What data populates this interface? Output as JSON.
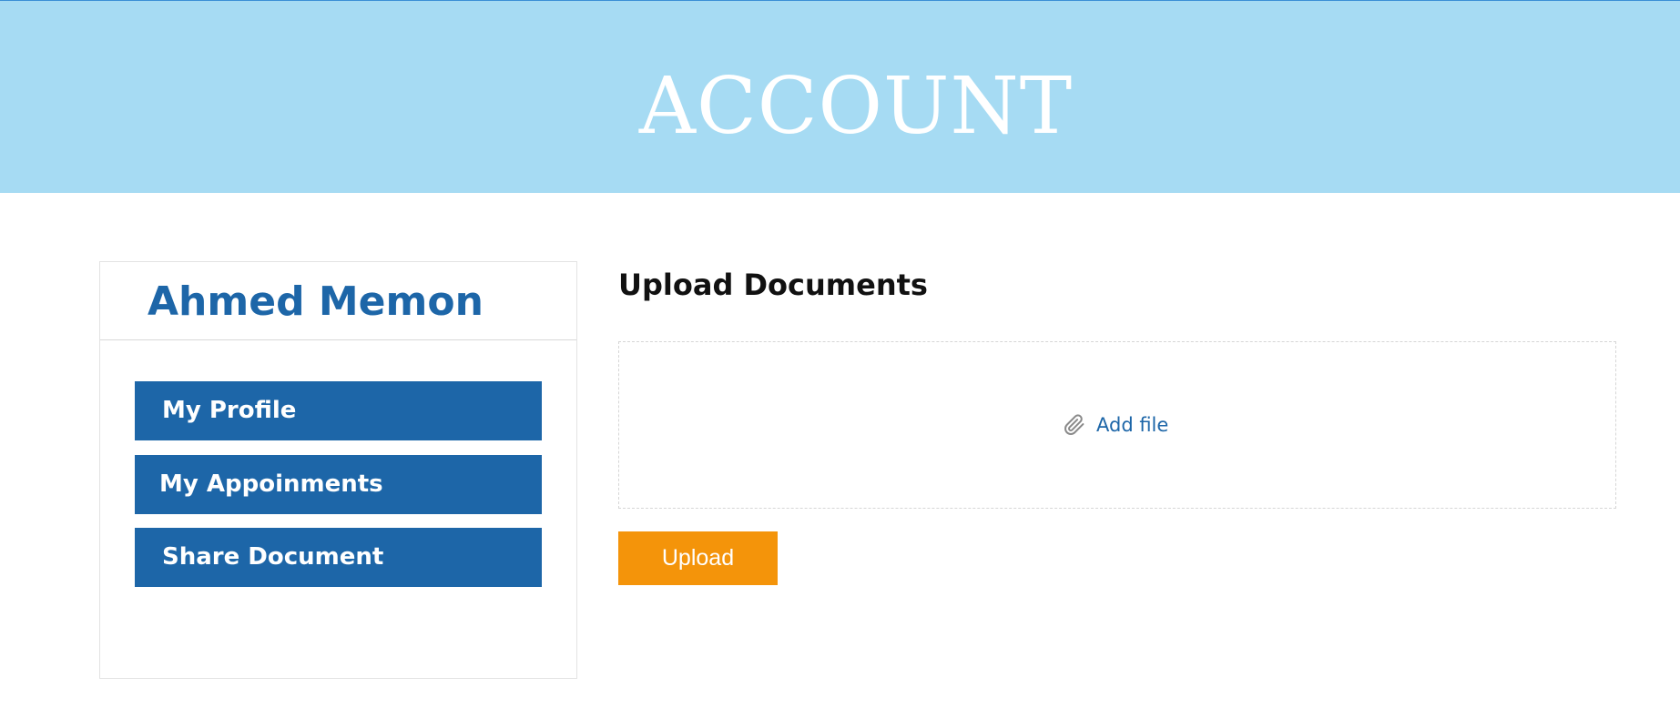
{
  "banner": {
    "title": "ACCOUNT"
  },
  "sidebar": {
    "user_name": "Ahmed Memon",
    "items": [
      {
        "label": "My Profile"
      },
      {
        "label": "My Appoinments"
      },
      {
        "label": "Share Document"
      }
    ]
  },
  "main": {
    "section_title": "Upload Documents",
    "add_file_label": "Add file",
    "add_file_icon": "paperclip-icon",
    "upload_label": "Upload"
  },
  "colors": {
    "banner_bg": "#a6dbf3",
    "primary_blue": "#1d66a8",
    "upload_orange": "#f4940a"
  }
}
